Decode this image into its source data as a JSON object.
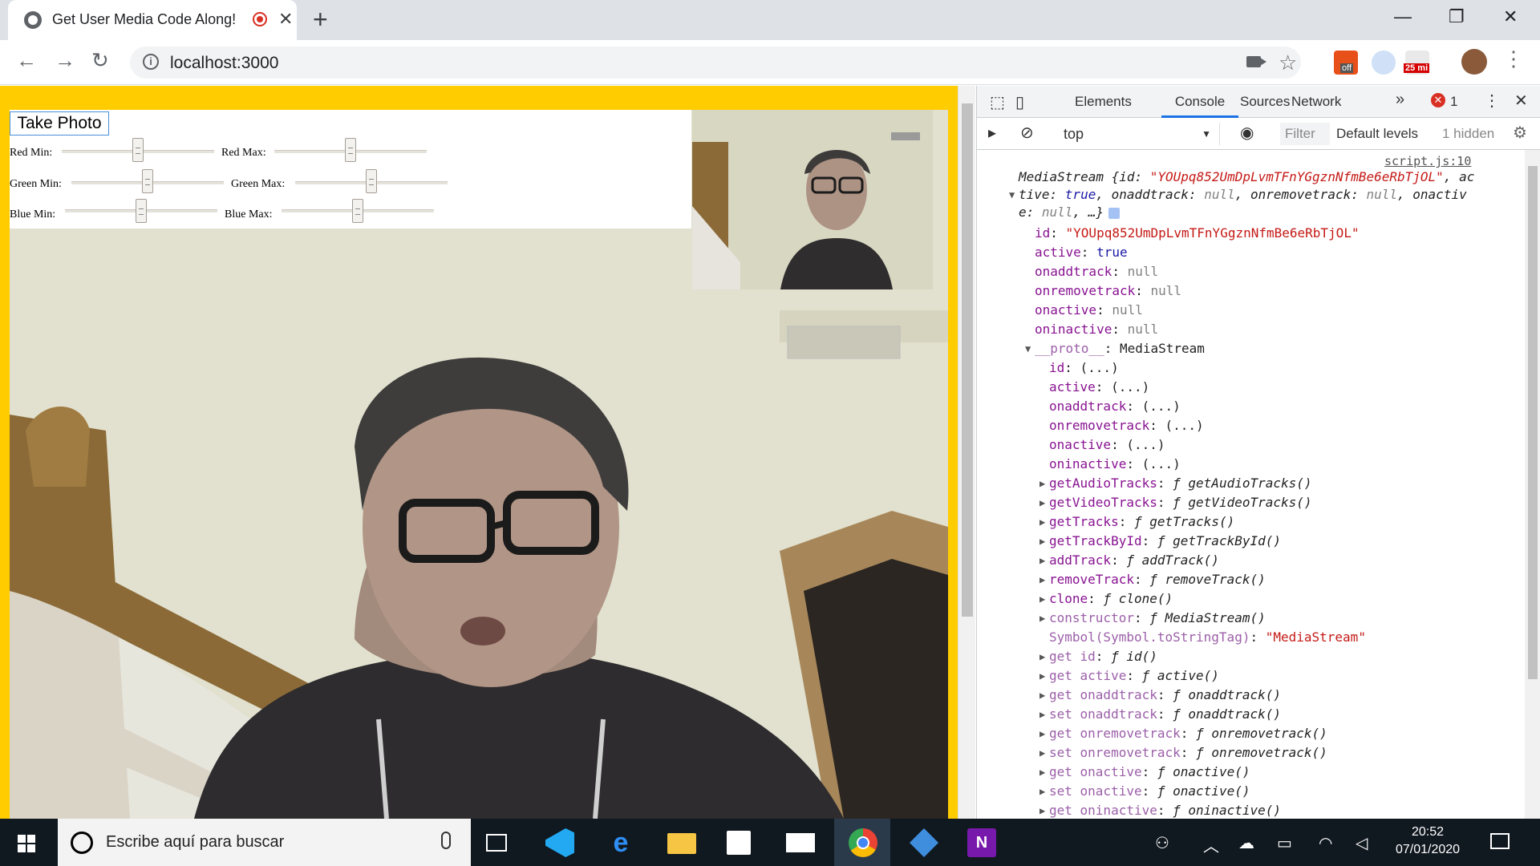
{
  "browser": {
    "tab_title": "Get User Media Code Along!",
    "tab_close": "✕",
    "new_tab": "+",
    "url": "localhost:3000",
    "url_info": "i",
    "window_controls": [
      "—",
      "❐",
      "✕"
    ],
    "ext_badge_off": "off",
    "ext_badge_time": "25 mi"
  },
  "page": {
    "take_photo_label": "Take Photo",
    "sliders": [
      {
        "label": "Red Min:",
        "value": 0.48
      },
      {
        "label": "Red Max:",
        "value": 0.5
      },
      {
        "label": "Green Min:",
        "value": 0.5
      },
      {
        "label": "Green Max:",
        "value": 0.5
      },
      {
        "label": "Blue Min:",
        "value": 0.5
      },
      {
        "label": "Blue Max:",
        "value": 0.5
      }
    ]
  },
  "devtools": {
    "tabs": [
      "Elements",
      "Console",
      "Sources",
      "Network"
    ],
    "more": "»",
    "error_count": "1",
    "context": "top",
    "filter_placeholder": "Filter",
    "levels": "Default levels",
    "hidden": "1 hidden",
    "source_link": "script.js:10",
    "console_summary": {
      "l1a": "MediaStream {id: ",
      "l1id": "\"YOUpq852UmDpLvmTFnYGgznNfmBe6eRbTjOL\"",
      "l1b": ", ac",
      "l2a": "tive: ",
      "l2true": "true",
      "l2b": ", onaddtrack: ",
      "l2null1": "null",
      "l2c": ", onremovetrack: ",
      "l2null2": "null",
      "l2d": ", onactiv",
      "l3a": "e: ",
      "l3null": "null",
      "l3b": ", …}"
    },
    "props": [
      {
        "key": "id",
        "val": "\"YOUpq852UmDpLvmTFnYGgznNfmBe6eRbTjOL\"",
        "kind": "str"
      },
      {
        "key": "active",
        "val": "true",
        "kind": "bool"
      },
      {
        "key": "onaddtrack",
        "val": "null",
        "kind": "null"
      },
      {
        "key": "onremovetrack",
        "val": "null",
        "kind": "null"
      },
      {
        "key": "onactive",
        "val": "null",
        "kind": "null"
      },
      {
        "key": "oninactive",
        "val": "null",
        "kind": "null"
      }
    ],
    "proto_key": "__proto__",
    "proto_val": "MediaStream",
    "proto_props": [
      {
        "key": "id",
        "val": "(...)"
      },
      {
        "key": "active",
        "val": "(...)"
      },
      {
        "key": "onaddtrack",
        "val": "(...)"
      },
      {
        "key": "onremovetrack",
        "val": "(...)"
      },
      {
        "key": "onactive",
        "val": "(...)"
      },
      {
        "key": "oninactive",
        "val": "(...)"
      }
    ],
    "proto_methods": [
      {
        "key": "getAudioTracks",
        "val": "getAudioTracks()"
      },
      {
        "key": "getVideoTracks",
        "val": "getVideoTracks()"
      },
      {
        "key": "getTracks",
        "val": "getTracks()"
      },
      {
        "key": "getTrackById",
        "val": "getTrackById()"
      },
      {
        "key": "addTrack",
        "val": "addTrack()"
      },
      {
        "key": "removeTrack",
        "val": "removeTrack()"
      },
      {
        "key": "clone",
        "val": "clone()"
      },
      {
        "key": "constructor",
        "val": "MediaStream()"
      }
    ],
    "symbol_key": "Symbol(Symbol.toStringTag)",
    "symbol_val": "\"MediaStream\"",
    "accessors": [
      {
        "key": "get id",
        "val": "id()"
      },
      {
        "key": "get active",
        "val": "active()"
      },
      {
        "key": "get onaddtrack",
        "val": "onaddtrack()"
      },
      {
        "key": "set onaddtrack",
        "val": "onaddtrack()"
      },
      {
        "key": "get onremovetrack",
        "val": "onremovetrack()"
      },
      {
        "key": "set onremovetrack",
        "val": "onremovetrack()"
      },
      {
        "key": "get onactive",
        "val": "onactive()"
      },
      {
        "key": "set onactive",
        "val": "onactive()"
      },
      {
        "key": "get oninactive",
        "val": "oninactive()"
      }
    ],
    "f": "ƒ"
  },
  "taskbar": {
    "search_placeholder": "Escribe aquí para buscar",
    "time": "20:52",
    "date": "07/01/2020"
  }
}
